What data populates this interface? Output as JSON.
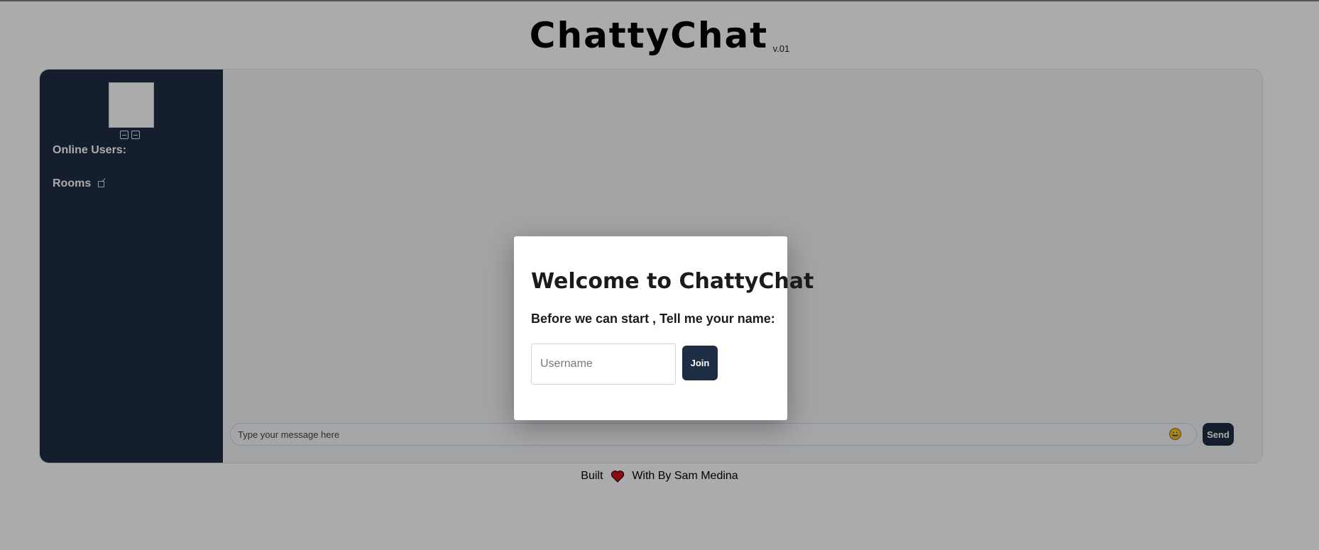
{
  "app": {
    "title": "ChattyChat",
    "version": "v.01"
  },
  "sidebar": {
    "online_users_label": "Online Users:",
    "rooms_label": "Rooms"
  },
  "composer": {
    "placeholder": "Type your message here",
    "send_label": "Send",
    "emoji": "😀"
  },
  "footer": {
    "prefix": "Built",
    "suffix": "With By Sam Medina"
  },
  "modal": {
    "title": "Welcome to ChattyChat",
    "subtitle": "Before we can start , Tell me your name:",
    "username_placeholder": "Username",
    "join_label": "Join"
  },
  "colors": {
    "sidebar_bg": "#1f2d44",
    "accent_button": "#1f2d44",
    "heart": "#d3131d",
    "overlay": "rgba(0,0,0,0.33)"
  },
  "icons": {
    "avatar_actions": [
      "save-icon",
      "upload-icon"
    ],
    "rooms_link": "external-link-icon",
    "footer": "heart-icon"
  }
}
